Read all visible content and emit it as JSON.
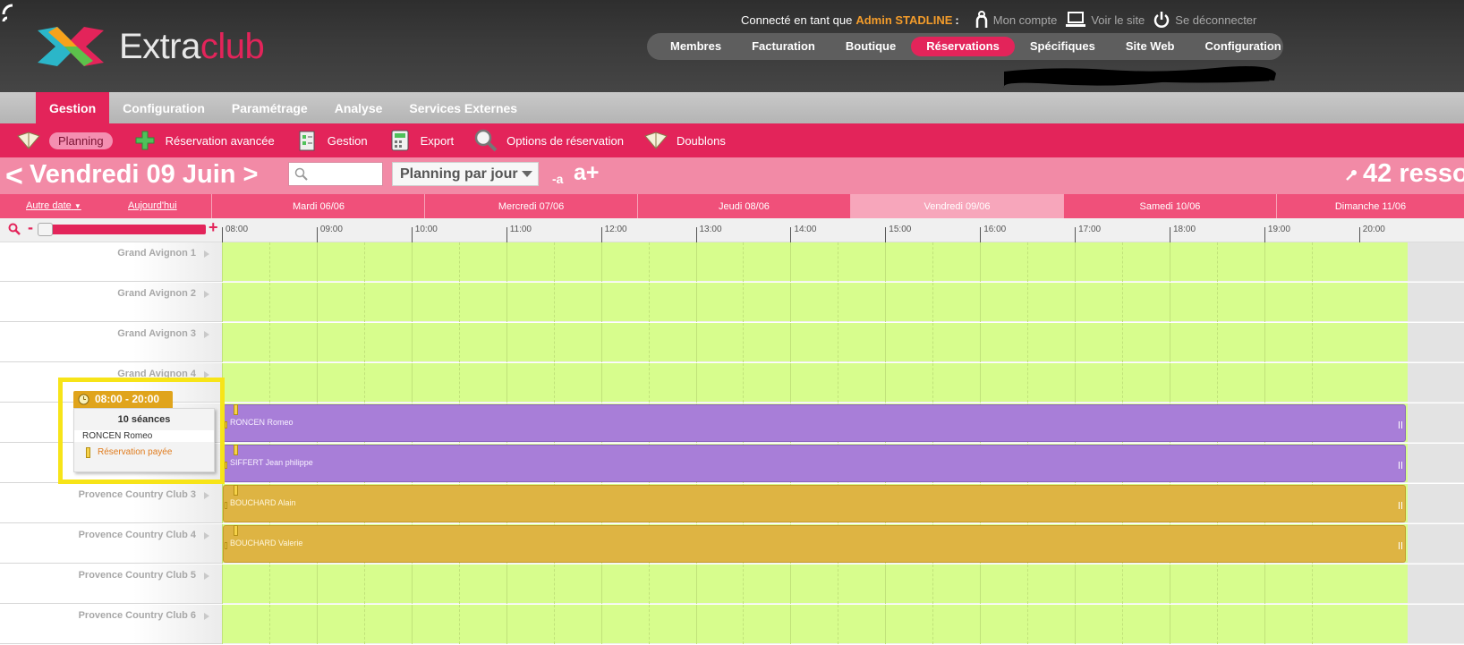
{
  "header": {
    "logo": {
      "text_main": "Extra",
      "text_accent": "club"
    },
    "user": {
      "prefix": "Connecté en tant que",
      "name": "Admin STADLINE",
      "colon": ":"
    },
    "links": [
      {
        "label": "Mon compte",
        "icon": "user-icon"
      },
      {
        "label": "Voir le site",
        "icon": "laptop-icon"
      },
      {
        "label": "Se déconnecter",
        "icon": "power-icon"
      }
    ],
    "main_nav": [
      {
        "label": "Membres",
        "active": false
      },
      {
        "label": "Facturation",
        "active": false
      },
      {
        "label": "Boutique",
        "active": false
      },
      {
        "label": "Réservations",
        "active": true
      },
      {
        "label": "Spécifiques",
        "active": false
      },
      {
        "label": "Site Web",
        "active": false
      },
      {
        "label": "Configuration",
        "active": false
      }
    ]
  },
  "sub_nav": [
    {
      "label": "Gestion",
      "active": true
    },
    {
      "label": "Configuration",
      "active": false
    },
    {
      "label": "Paramétrage",
      "active": false
    },
    {
      "label": "Analyse",
      "active": false
    },
    {
      "label": "Services Externes",
      "active": false
    }
  ],
  "toolbar": [
    {
      "label": "Planning",
      "icon": "planning-book-icon"
    },
    {
      "label": "Réservation avancée",
      "icon": "add-cross-icon"
    },
    {
      "label": "Gestion",
      "icon": "checklist-icon"
    },
    {
      "label": "Export",
      "icon": "calculator-icon"
    },
    {
      "label": "Options de réservation",
      "icon": "magnifier-icon"
    },
    {
      "label": "Doublons",
      "icon": "doublons-book-icon"
    }
  ],
  "datebar": {
    "prev": "<",
    "title": "Vendredi 09 Juin",
    "next": ">",
    "search_placeholder": "",
    "view_select": "Planning par jour",
    "font_smaller": "-a",
    "font_larger": "a+",
    "resources": "42 resso"
  },
  "days_header": {
    "other_date": "Autre date",
    "today": "Aujourd'hui",
    "days": [
      {
        "label": "Mardi 06/06",
        "active": false
      },
      {
        "label": "Mercredi 07/06",
        "active": false
      },
      {
        "label": "Jeudi 08/06",
        "active": false
      },
      {
        "label": "Vendredi 09/06",
        "active": true
      },
      {
        "label": "Samedi 10/06",
        "active": false
      },
      {
        "label": "Dimanche 11/06",
        "active": false
      }
    ]
  },
  "timeline": {
    "zoom_minus": "-",
    "zoom_plus": "+",
    "zoom_level": 0,
    "hours": [
      "08:00",
      "09:00",
      "10:00",
      "11:00",
      "12:00",
      "13:00",
      "14:00",
      "15:00",
      "16:00",
      "17:00",
      "18:00",
      "19:00",
      "20:00"
    ]
  },
  "resources": [
    {
      "name": "Grand Avignon 1",
      "booking": null
    },
    {
      "name": "Grand Avignon 2",
      "booking": null
    },
    {
      "name": "Grand Avignon 3",
      "booking": null
    },
    {
      "name": "Grand Avignon 4",
      "booking": null
    },
    {
      "name": "",
      "booking": {
        "person": "RONCEN Romeo",
        "color": "#a87ed8"
      }
    },
    {
      "name": "",
      "booking": {
        "person": "SIFFERT Jean philippe",
        "color": "#a87ed8"
      }
    },
    {
      "name": "Provence Country Club 3",
      "booking": {
        "person": "BOUCHARD Alain",
        "color": "#deb443"
      }
    },
    {
      "name": "Provence Country Club 4",
      "booking": {
        "person": "BOUCHARD Valerie",
        "color": "#deb443"
      }
    },
    {
      "name": "Provence Country Club 5",
      "booking": null
    },
    {
      "name": "Provence Country Club 6",
      "booking": null
    }
  ],
  "popup": {
    "time": "08:00 - 20:00",
    "sessions": "10 séances",
    "person": "RONCEN Romeo",
    "status": "Réservation payée"
  },
  "colors": {
    "brand_pink": "#e3245a",
    "accent_orange": "#f39c2b",
    "free_slot": "#d7fd8d",
    "closed_slot": "#e3e3e3"
  }
}
